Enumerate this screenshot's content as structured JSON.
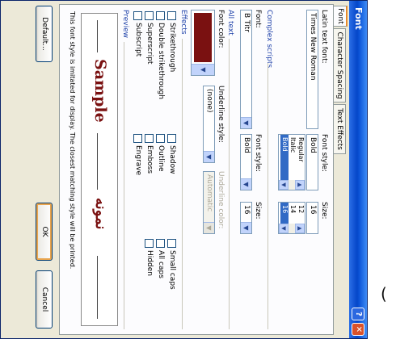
{
  "window": {
    "title": "Font",
    "help_label": "?",
    "close_label": "✕"
  },
  "tabs": [
    {
      "label": "Font",
      "active": true
    },
    {
      "label": "Character Spacing",
      "active": false
    },
    {
      "label": "Text Effects",
      "active": false
    }
  ],
  "latin": {
    "font_label": "Latin text font:",
    "font_value": "Times New Roman",
    "style_label": "Font style:",
    "style_value": "Bold",
    "style_options": [
      "Regular",
      "Italic",
      "Bold"
    ],
    "style_selected": "Bold",
    "size_label": "Size:",
    "size_value": "16",
    "size_options": [
      "12",
      "14",
      "16"
    ],
    "size_selected": "16"
  },
  "complex": {
    "section": "Complex scripts",
    "font_label": "Font:",
    "font_value": "B Titr",
    "style_label": "Font style:",
    "style_value": "Bold",
    "size_label": "Size:",
    "size_value": "16"
  },
  "all_text": {
    "section": "All text",
    "color_label": "Font color:",
    "color_value": "#7a1111",
    "underline_style_label": "Underline style:",
    "underline_style_value": "(none)",
    "underline_color_label": "Underline color:",
    "underline_color_value": "Automatic"
  },
  "effects": {
    "section": "Effects",
    "items": [
      {
        "label": "Strikethrough",
        "checked": false
      },
      {
        "label": "Double strikethrough",
        "checked": false
      },
      {
        "label": "Superscript",
        "checked": false
      },
      {
        "label": "Subscript",
        "checked": false
      },
      {
        "label": "Shadow",
        "checked": false
      },
      {
        "label": "Outline",
        "checked": false
      },
      {
        "label": "Emboss",
        "checked": false
      },
      {
        "label": "Engrave",
        "checked": false
      },
      {
        "label": "Small caps",
        "checked": false
      },
      {
        "label": "All caps",
        "checked": false
      },
      {
        "label": "Hidden",
        "checked": false
      }
    ]
  },
  "preview": {
    "section": "Preview",
    "sample_text": "Sample",
    "arabic_sample": "نمونه",
    "note": "This font style is imitated for display. The closest matching style will be printed."
  },
  "buttons": {
    "default": "Default...",
    "ok": "OK",
    "cancel": "Cancel"
  },
  "colors": {
    "accent_tab": "#e68b2c",
    "titlebar": "#0a52d6",
    "font_color": "#7a1111",
    "selection": "#316ac5"
  },
  "overlay": {
    "glyph": "("
  }
}
